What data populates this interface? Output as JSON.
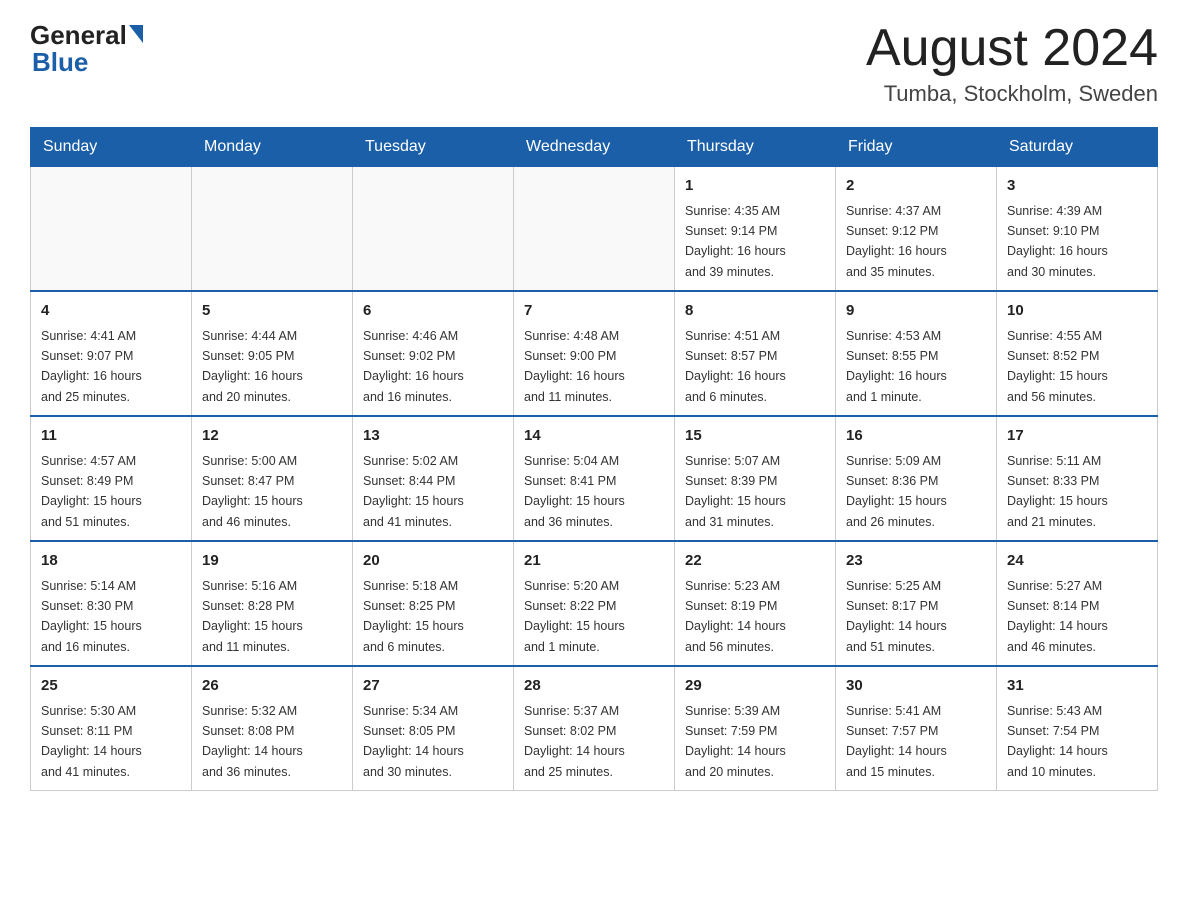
{
  "header": {
    "logo_general": "General",
    "logo_blue": "Blue",
    "month_title": "August 2024",
    "location": "Tumba, Stockholm, Sweden"
  },
  "days_of_week": [
    "Sunday",
    "Monday",
    "Tuesday",
    "Wednesday",
    "Thursday",
    "Friday",
    "Saturday"
  ],
  "weeks": [
    [
      {
        "day": "",
        "info": ""
      },
      {
        "day": "",
        "info": ""
      },
      {
        "day": "",
        "info": ""
      },
      {
        "day": "",
        "info": ""
      },
      {
        "day": "1",
        "info": "Sunrise: 4:35 AM\nSunset: 9:14 PM\nDaylight: 16 hours\nand 39 minutes."
      },
      {
        "day": "2",
        "info": "Sunrise: 4:37 AM\nSunset: 9:12 PM\nDaylight: 16 hours\nand 35 minutes."
      },
      {
        "day": "3",
        "info": "Sunrise: 4:39 AM\nSunset: 9:10 PM\nDaylight: 16 hours\nand 30 minutes."
      }
    ],
    [
      {
        "day": "4",
        "info": "Sunrise: 4:41 AM\nSunset: 9:07 PM\nDaylight: 16 hours\nand 25 minutes."
      },
      {
        "day": "5",
        "info": "Sunrise: 4:44 AM\nSunset: 9:05 PM\nDaylight: 16 hours\nand 20 minutes."
      },
      {
        "day": "6",
        "info": "Sunrise: 4:46 AM\nSunset: 9:02 PM\nDaylight: 16 hours\nand 16 minutes."
      },
      {
        "day": "7",
        "info": "Sunrise: 4:48 AM\nSunset: 9:00 PM\nDaylight: 16 hours\nand 11 minutes."
      },
      {
        "day": "8",
        "info": "Sunrise: 4:51 AM\nSunset: 8:57 PM\nDaylight: 16 hours\nand 6 minutes."
      },
      {
        "day": "9",
        "info": "Sunrise: 4:53 AM\nSunset: 8:55 PM\nDaylight: 16 hours\nand 1 minute."
      },
      {
        "day": "10",
        "info": "Sunrise: 4:55 AM\nSunset: 8:52 PM\nDaylight: 15 hours\nand 56 minutes."
      }
    ],
    [
      {
        "day": "11",
        "info": "Sunrise: 4:57 AM\nSunset: 8:49 PM\nDaylight: 15 hours\nand 51 minutes."
      },
      {
        "day": "12",
        "info": "Sunrise: 5:00 AM\nSunset: 8:47 PM\nDaylight: 15 hours\nand 46 minutes."
      },
      {
        "day": "13",
        "info": "Sunrise: 5:02 AM\nSunset: 8:44 PM\nDaylight: 15 hours\nand 41 minutes."
      },
      {
        "day": "14",
        "info": "Sunrise: 5:04 AM\nSunset: 8:41 PM\nDaylight: 15 hours\nand 36 minutes."
      },
      {
        "day": "15",
        "info": "Sunrise: 5:07 AM\nSunset: 8:39 PM\nDaylight: 15 hours\nand 31 minutes."
      },
      {
        "day": "16",
        "info": "Sunrise: 5:09 AM\nSunset: 8:36 PM\nDaylight: 15 hours\nand 26 minutes."
      },
      {
        "day": "17",
        "info": "Sunrise: 5:11 AM\nSunset: 8:33 PM\nDaylight: 15 hours\nand 21 minutes."
      }
    ],
    [
      {
        "day": "18",
        "info": "Sunrise: 5:14 AM\nSunset: 8:30 PM\nDaylight: 15 hours\nand 16 minutes."
      },
      {
        "day": "19",
        "info": "Sunrise: 5:16 AM\nSunset: 8:28 PM\nDaylight: 15 hours\nand 11 minutes."
      },
      {
        "day": "20",
        "info": "Sunrise: 5:18 AM\nSunset: 8:25 PM\nDaylight: 15 hours\nand 6 minutes."
      },
      {
        "day": "21",
        "info": "Sunrise: 5:20 AM\nSunset: 8:22 PM\nDaylight: 15 hours\nand 1 minute."
      },
      {
        "day": "22",
        "info": "Sunrise: 5:23 AM\nSunset: 8:19 PM\nDaylight: 14 hours\nand 56 minutes."
      },
      {
        "day": "23",
        "info": "Sunrise: 5:25 AM\nSunset: 8:17 PM\nDaylight: 14 hours\nand 51 minutes."
      },
      {
        "day": "24",
        "info": "Sunrise: 5:27 AM\nSunset: 8:14 PM\nDaylight: 14 hours\nand 46 minutes."
      }
    ],
    [
      {
        "day": "25",
        "info": "Sunrise: 5:30 AM\nSunset: 8:11 PM\nDaylight: 14 hours\nand 41 minutes."
      },
      {
        "day": "26",
        "info": "Sunrise: 5:32 AM\nSunset: 8:08 PM\nDaylight: 14 hours\nand 36 minutes."
      },
      {
        "day": "27",
        "info": "Sunrise: 5:34 AM\nSunset: 8:05 PM\nDaylight: 14 hours\nand 30 minutes."
      },
      {
        "day": "28",
        "info": "Sunrise: 5:37 AM\nSunset: 8:02 PM\nDaylight: 14 hours\nand 25 minutes."
      },
      {
        "day": "29",
        "info": "Sunrise: 5:39 AM\nSunset: 7:59 PM\nDaylight: 14 hours\nand 20 minutes."
      },
      {
        "day": "30",
        "info": "Sunrise: 5:41 AM\nSunset: 7:57 PM\nDaylight: 14 hours\nand 15 minutes."
      },
      {
        "day": "31",
        "info": "Sunrise: 5:43 AM\nSunset: 7:54 PM\nDaylight: 14 hours\nand 10 minutes."
      }
    ]
  ]
}
